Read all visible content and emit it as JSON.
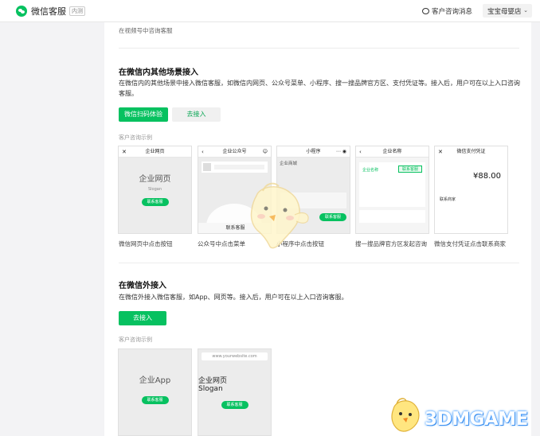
{
  "topbar": {
    "app_name": "微信客服",
    "app_tag": "内测",
    "messages_label": "客户咨询消息",
    "shop_name": "宝宝母婴店"
  },
  "top_note": "在视频号中咨询客服",
  "inside": {
    "title": "在微信内其他场景接入",
    "desc": "在微信内的其他场景中接入微信客服，如微信内网页、公众号菜单、小程序、搜一搜品牌官方区、支付凭证等。接入后，用户可在以上入口咨询客服。",
    "primary_btn": "微信扫码体验",
    "secondary_btn": "去接入",
    "examples_label": "客户咨询示例",
    "cards": [
      {
        "header": "企业网页",
        "body": "企业网页",
        "slogan": "Slogan",
        "pill": "联系客服",
        "caption": "微信网页中点击按钮"
      },
      {
        "header": "企业公众号",
        "body": "",
        "slogan": "",
        "pill": "联系客服",
        "caption": "公众号中点击菜单"
      },
      {
        "header": "小程序",
        "body": "企业商城",
        "slogan": "",
        "pill": "联系客服",
        "caption": "小程序中点击按钮"
      },
      {
        "header": "企业名称",
        "body": "企业名称",
        "slogan": "",
        "pill": "联系客服",
        "caption": "搜一搜品牌官方区发起咨询"
      },
      {
        "header": "微信支付凭证",
        "body": "¥88.00",
        "slogan": "联系商家",
        "pill": "",
        "caption": "微信支付凭证点击联系商家"
      }
    ]
  },
  "outside": {
    "title": "在微信外接入",
    "desc": "在微信外接入微信客服，如App、网页等。接入后，用户可在以上入口咨询客服。",
    "primary_btn": "去接入",
    "examples_label": "客户咨询示例",
    "cards": [
      {
        "url": "",
        "body": "企业App",
        "slogan": "",
        "pill": "联系客服"
      },
      {
        "url": "www.yourwebsite.com",
        "body": "企业网页",
        "slogan": "Slogan",
        "pill": "联系客服"
      }
    ]
  },
  "watermark": "3DMGAME"
}
